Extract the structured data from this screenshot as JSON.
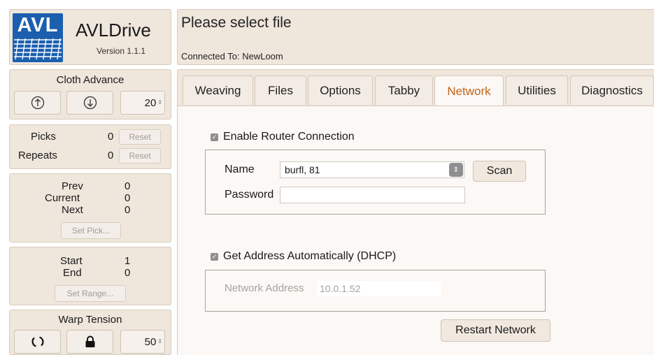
{
  "app": {
    "logo_text": "AVL",
    "title": "AVLDrive",
    "version": "Version 1.1.1"
  },
  "header": {
    "title": "Please select file",
    "connected": "Connected To: NewLoom"
  },
  "cloth_advance": {
    "title": "Cloth Advance",
    "up_icon": "arrow-up-circle-icon",
    "down_icon": "arrow-down-circle-icon",
    "value": "20"
  },
  "counters": {
    "picks_label": "Picks",
    "picks_value": "0",
    "repeats_label": "Repeats",
    "repeats_value": "0",
    "reset_label": "Reset"
  },
  "pick_panel": {
    "prev_label": "Prev",
    "prev_value": "0",
    "current_label": "Current",
    "current_value": "0",
    "next_label": "Next",
    "next_value": "0",
    "button": "Set Pick..."
  },
  "range_panel": {
    "start_label": "Start",
    "start_value": "1",
    "end_label": "End",
    "end_value": "0",
    "button": "Set Range..."
  },
  "warp_tension": {
    "title": "Warp Tension",
    "refresh_icon": "refresh-icon",
    "lock_icon": "lock-icon",
    "value": "50"
  },
  "tabs": [
    "Weaving",
    "Files",
    "Options",
    "Tabby",
    "Network",
    "Utilities",
    "Diagnostics"
  ],
  "active_tab": "Network",
  "network": {
    "router_label": "Enable Router Connection",
    "name_label": "Name",
    "name_value": "burfl, 81",
    "scan_label": "Scan",
    "password_label": "Password",
    "password_value": "",
    "dhcp_label": "Get Address Automatically (DHCP)",
    "address_label": "Network Address",
    "address_value": "10.0.1.52",
    "restart_label": "Restart Network"
  },
  "colors": {
    "panel": "#efe6dc",
    "accent": "#c0651a",
    "logo_blue": "#1b5fae"
  }
}
